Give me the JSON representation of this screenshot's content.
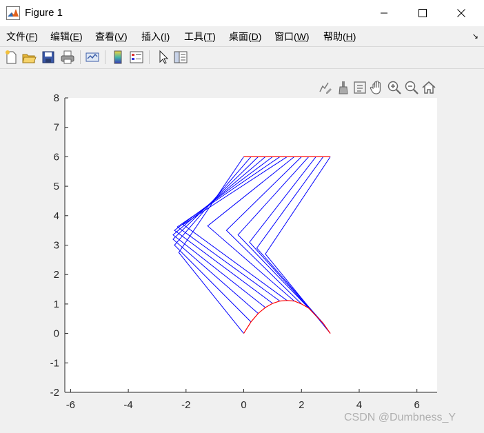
{
  "window": {
    "title": "Figure 1"
  },
  "menu": [
    {
      "label": "文件(",
      "accel": "F",
      "tail": ")"
    },
    {
      "label": "编辑(",
      "accel": "E",
      "tail": ")"
    },
    {
      "label": "查看(",
      "accel": "V",
      "tail": ")"
    },
    {
      "label": "插入(",
      "accel": "I",
      "tail": ")"
    },
    {
      "label": "工具(",
      "accel": "T",
      "tail": ")"
    },
    {
      "label": "桌面(",
      "accel": "D",
      "tail": ")"
    },
    {
      "label": "窗口(",
      "accel": "W",
      "tail": ")"
    },
    {
      "label": "帮助(",
      "accel": "H",
      "tail": ")"
    }
  ],
  "toolbar_icons": [
    "new-figure-icon",
    "open-file-icon",
    "save-icon",
    "print-icon",
    "link-plot-icon",
    "insert-colorbar-icon",
    "insert-legend-icon",
    "edit-plot-arrow-icon",
    "property-inspector-icon"
  ],
  "axes_toolbar_icons": [
    "edit-data-tips-icon",
    "brush-icon",
    "data-cursor-icon",
    "pan-hand-icon",
    "zoom-in-icon",
    "zoom-out-icon",
    "home-icon"
  ],
  "watermark": "CSDN @Dumbness_Y",
  "chart_data": {
    "type": "line",
    "title": "",
    "xlabel": "",
    "ylabel": "",
    "xlim": [
      -6.2,
      6.7
    ],
    "ylim": [
      -2,
      8
    ],
    "xticks": [
      -6,
      -4,
      -2,
      0,
      2,
      4,
      6
    ],
    "yticks": [
      -2,
      -1,
      0,
      1,
      2,
      3,
      4,
      5,
      6,
      7,
      8
    ],
    "xtick_labels": [
      "-6",
      "-4",
      "-2",
      "0",
      "2",
      "4",
      "6"
    ],
    "ytick_labels": [
      "-2",
      "-1",
      "0",
      "1",
      "2",
      "3",
      "4",
      "5",
      "6",
      "7",
      "8"
    ],
    "grid": false,
    "colors": {
      "linkage": "#0000ff",
      "trajectory": "#ff0000",
      "axes_bg": "#ffffff"
    },
    "linkage_frames": [
      [
        [
          0.0,
          0.0
        ],
        [
          -2.25,
          2.75
        ],
        [
          0.0,
          6.0
        ]
      ],
      [
        [
          0.25,
          0.39
        ],
        [
          -2.4,
          3.0
        ],
        [
          0.25,
          6.0
        ]
      ],
      [
        [
          0.5,
          0.68
        ],
        [
          -2.45,
          3.2
        ],
        [
          0.5,
          6.0
        ]
      ],
      [
        [
          0.75,
          0.88
        ],
        [
          -2.45,
          3.35
        ],
        [
          0.75,
          6.0
        ]
      ],
      [
        [
          1.0,
          1.02
        ],
        [
          -2.4,
          3.5
        ],
        [
          1.0,
          6.0
        ]
      ],
      [
        [
          1.25,
          1.1
        ],
        [
          -2.3,
          3.62
        ],
        [
          1.25,
          6.0
        ]
      ],
      [
        [
          1.5,
          1.12
        ],
        [
          -2.1,
          3.7
        ],
        [
          1.5,
          6.0
        ]
      ],
      [
        [
          1.75,
          1.1
        ],
        [
          -1.25,
          3.65
        ],
        [
          1.75,
          6.0
        ]
      ],
      [
        [
          2.0,
          1.0
        ],
        [
          -0.6,
          3.5
        ],
        [
          2.0,
          6.0
        ]
      ],
      [
        [
          2.25,
          0.86
        ],
        [
          -0.2,
          3.35
        ],
        [
          2.25,
          6.0
        ]
      ],
      [
        [
          2.5,
          0.6
        ],
        [
          0.2,
          3.1
        ],
        [
          2.5,
          6.0
        ]
      ],
      [
        [
          2.75,
          0.35
        ],
        [
          0.45,
          2.9
        ],
        [
          2.75,
          6.0
        ]
      ],
      [
        [
          3.0,
          0.0
        ],
        [
          0.75,
          2.7
        ],
        [
          3.0,
          6.0
        ]
      ]
    ],
    "trajectory_lower": [
      [
        0.0,
        0.0
      ],
      [
        0.25,
        0.39
      ],
      [
        0.5,
        0.68
      ],
      [
        0.75,
        0.88
      ],
      [
        1.0,
        1.02
      ],
      [
        1.25,
        1.1
      ],
      [
        1.5,
        1.12
      ],
      [
        1.75,
        1.1
      ],
      [
        2.0,
        1.0
      ],
      [
        2.25,
        0.86
      ],
      [
        2.5,
        0.6
      ],
      [
        2.75,
        0.35
      ],
      [
        3.0,
        0.0
      ]
    ],
    "trajectory_upper": [
      [
        0.0,
        6.0
      ],
      [
        3.0,
        6.0
      ]
    ]
  }
}
